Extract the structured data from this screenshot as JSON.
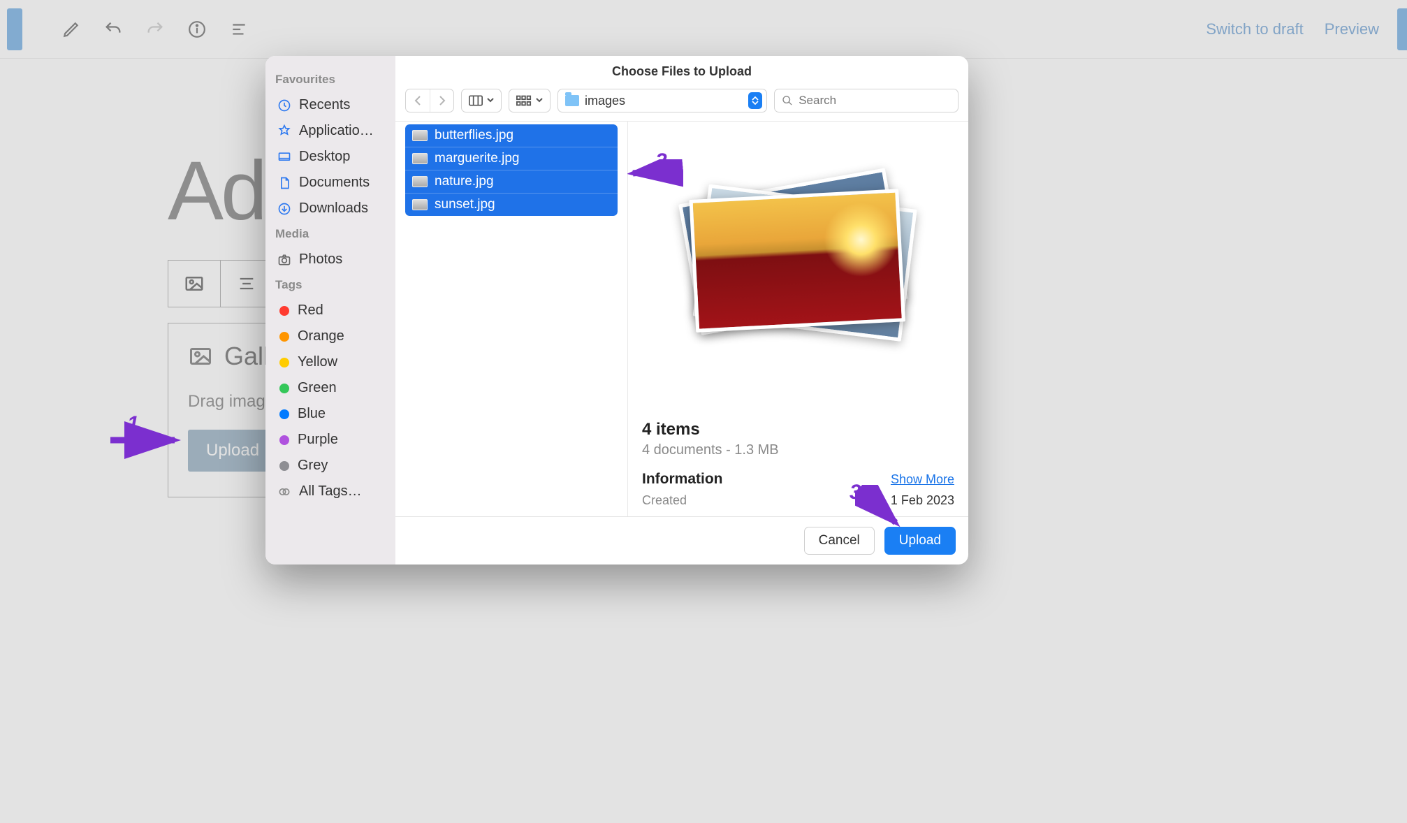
{
  "topbar": {
    "switch_draft": "Switch to draft",
    "preview": "Preview"
  },
  "editor": {
    "title_partial": "Ad",
    "gallery_label": "Galle",
    "drag_text": "Drag images,",
    "upload_label": "Upload"
  },
  "annotations": {
    "n1": "1",
    "n2": "2",
    "n3": "3"
  },
  "finder": {
    "title": "Choose Files to Upload",
    "sidebar": {
      "favourites_head": "Favourites",
      "favourites": [
        "Recents",
        "Applicatio…",
        "Desktop",
        "Documents",
        "Downloads"
      ],
      "media_head": "Media",
      "media": [
        "Photos"
      ],
      "tags_head": "Tags",
      "tags": [
        {
          "label": "Red",
          "color": "#ff3b30"
        },
        {
          "label": "Orange",
          "color": "#ff9500"
        },
        {
          "label": "Yellow",
          "color": "#ffcc00"
        },
        {
          "label": "Green",
          "color": "#34c759"
        },
        {
          "label": "Blue",
          "color": "#007aff"
        },
        {
          "label": "Purple",
          "color": "#af52de"
        },
        {
          "label": "Grey",
          "color": "#8e8e93"
        }
      ],
      "all_tags": "All Tags…"
    },
    "path_label": "images",
    "search_placeholder": "Search",
    "files": [
      "butterflies.jpg",
      "marguerite.jpg",
      "nature.jpg",
      "sunset.jpg"
    ],
    "info": {
      "items": "4 items",
      "sub": "4 documents - 1.3 MB",
      "information": "Information",
      "show_more": "Show More",
      "created_k": "Created",
      "created_v": "1 Feb 2023"
    },
    "footer": {
      "cancel": "Cancel",
      "upload": "Upload"
    }
  }
}
